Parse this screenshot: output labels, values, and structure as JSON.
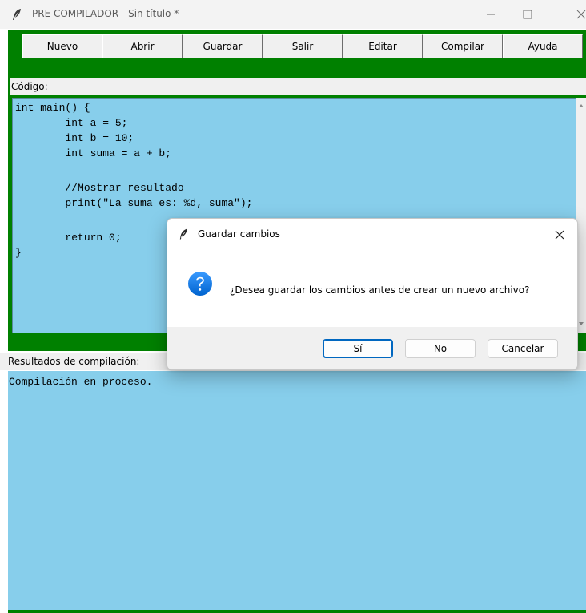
{
  "window": {
    "title": "PRE COMPILADOR - Sin título *"
  },
  "toolbar": {
    "buttons": [
      "Nuevo",
      "Abrir",
      "Guardar",
      "Salir",
      "Editar",
      "Compilar",
      "Ayuda"
    ]
  },
  "editor": {
    "label": "Código:",
    "lines": [
      "int main() {",
      "        int a = 5;",
      "        int b = 10;",
      "        int suma = a + b;",
      "",
      "        //Mostrar resultado",
      "        print(\"La suma es: %d, suma\");",
      "",
      "        return 0;",
      "}"
    ]
  },
  "results": {
    "label": "Resultados de compilación:",
    "text": "Compilación en proceso."
  },
  "dialog": {
    "title": "Guardar cambios",
    "message": "¿Desea guardar los cambios antes de crear un nuevo archivo?",
    "buttons": {
      "yes": "Sí",
      "no": "No",
      "cancel": "Cancelar"
    }
  },
  "icons": {
    "app": "feather-icon",
    "question": "question-icon"
  },
  "colors": {
    "frame": "#008000",
    "text_area": "#87ceeb",
    "accent": "#0067c0"
  }
}
